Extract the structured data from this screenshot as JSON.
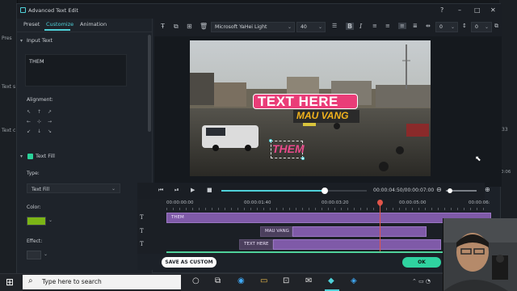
{
  "background_app": {
    "left_labels": [
      "Pres",
      "Text s",
      "Text c"
    ],
    "right_labels": [
      "33",
      "0:06"
    ]
  },
  "dialog": {
    "title": "Advanced Text Edit",
    "window_buttons": [
      "?",
      "–",
      "□",
      "✕"
    ]
  },
  "left_panel": {
    "tabs": [
      {
        "label": "Preset",
        "active": false
      },
      {
        "label": "Customize",
        "active": true
      },
      {
        "label": "Animation",
        "active": false
      }
    ],
    "input_text_label": "Input Text",
    "input_text_value": "THEM",
    "alignment_label": "Alignment:",
    "text_fill_label": "Text Fill",
    "type_label": "Type:",
    "type_value": "Text Fill",
    "color_label": "Color:",
    "color_value": "#7cb516",
    "effect_label": "Effect:"
  },
  "toolbar": {
    "font": "Microsoft YaHei Light",
    "size": "40",
    "bold": "B",
    "italic": "I",
    "spacing1": "0",
    "spacing2": "0"
  },
  "video": {
    "title_main": "TEXT HERE",
    "title_sub": "MAU VANG",
    "selected_text": "THEM",
    "colors": {
      "banner": "#e83e7a",
      "sub": "#f2b21c",
      "selected": "#e84a8a"
    }
  },
  "playback": {
    "timecode": "00:00:04:50/00:00:07:00",
    "progress": 0.71
  },
  "timeline": {
    "ruler": [
      "00:00:00:00",
      "00:00:01:40",
      "00:00:03:20",
      "00:00:05:00",
      "00:00:06:"
    ],
    "playhead": 0.67,
    "tracks": [
      {
        "label": "THEM",
        "type_icon": "T"
      },
      {
        "label": "MAU VANG",
        "type_icon": "T"
      },
      {
        "label": "TEXT HERE",
        "type_icon": "T"
      }
    ]
  },
  "footer": {
    "save_custom": "SAVE AS CUSTOM",
    "ok": "OK"
  },
  "taskbar": {
    "search_placeholder": "Type here to search"
  }
}
